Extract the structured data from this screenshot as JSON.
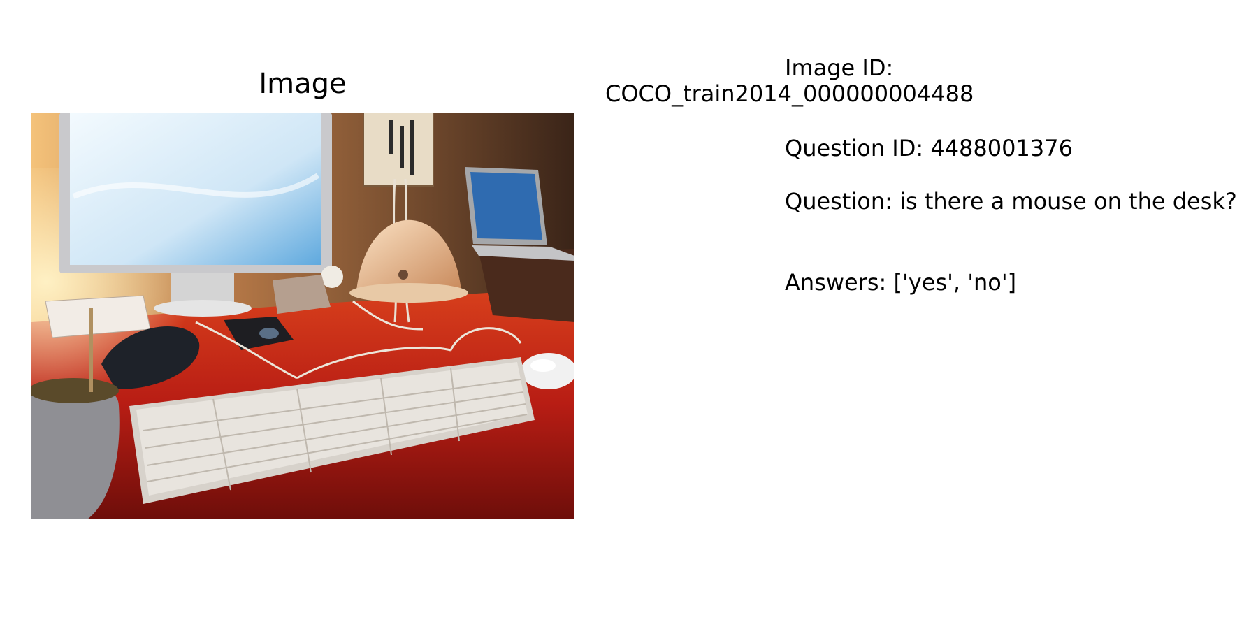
{
  "panel": {
    "title": "Image"
  },
  "info": {
    "image_id_label": "Image ID:",
    "image_id_value": "COCO_train2014_000000004488",
    "question_id": "Question ID: 4488001376",
    "question": "Question: is there a mouse on the desk?",
    "answers": "Answers: ['yes', 'no']"
  },
  "photo": {
    "subject_icon": "desk-computer-photo",
    "colors": {
      "desk": "#b81d14",
      "wall": "#6b3f27",
      "screen": "#cfe6f6",
      "keyboard": "#e8e4de"
    }
  }
}
